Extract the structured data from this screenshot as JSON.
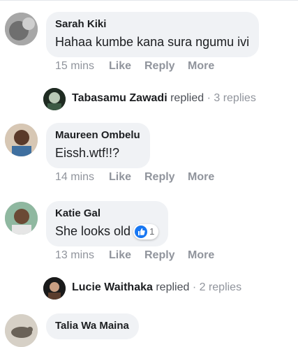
{
  "comments": [
    {
      "author": "Sarah Kiki",
      "text": "Hahaa kumbe kana sura ngumu ivi",
      "time": "15 mins",
      "like": "Like",
      "reply": "Reply",
      "more": "More",
      "replies": {
        "author": "Tabasamu Zawadi",
        "verb": "replied",
        "sep": " · ",
        "count": "3 replies"
      }
    },
    {
      "author": "Maureen Ombelu",
      "text": "Eissh.wtf!!?",
      "time": "14 mins",
      "like": "Like",
      "reply": "Reply",
      "more": "More"
    },
    {
      "author": "Katie Gal",
      "text": "She looks old",
      "time": "13 mins",
      "like": "Like",
      "reply": "Reply",
      "more": "More",
      "reaction": {
        "icon": "like-icon",
        "count": "1",
        "color": "#1877f2"
      },
      "replies": {
        "author": "Lucie Waithaka",
        "verb": "replied",
        "sep": " · ",
        "count": "2 replies"
      }
    },
    {
      "author": "Talia Wa Maina"
    }
  ],
  "colors": {
    "bubble": "#f0f2f5",
    "meta": "#90949c",
    "name": "#1c1e21"
  }
}
